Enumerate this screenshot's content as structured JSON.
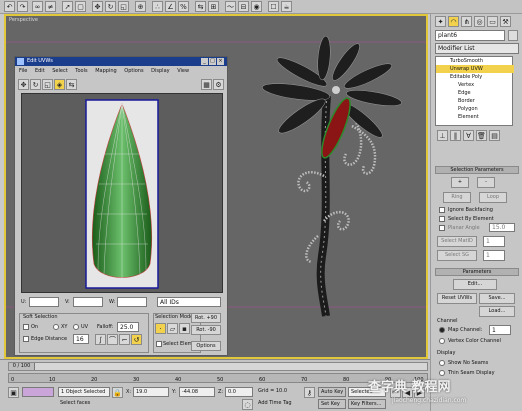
{
  "viewport": {
    "label": "Perspective"
  },
  "command_panel": {
    "object_name": "plant6",
    "modifier_list": "Modifier List",
    "stack": [
      {
        "label": "TurboSmooth"
      },
      {
        "label": "Unwrap UVW"
      },
      {
        "label": "Editable Poly"
      },
      {
        "label": "Vertex"
      },
      {
        "label": "Edge"
      },
      {
        "label": "Border"
      },
      {
        "label": "Polygon"
      },
      {
        "label": "Element"
      }
    ],
    "selection_params": {
      "title": "Selection Parameters",
      "plus": "+",
      "minus": "-",
      "ring": "Ring",
      "loop": "Loop",
      "ignore_backfacing": "Ignore Backfacing",
      "select_by_element": "Select By Element",
      "planar_angle": "Planar Angle",
      "planar_value": "15.0",
      "select_matid": "Select MatID",
      "select_sg": "Select SG",
      "matid_value": "1",
      "sg_value": "1"
    },
    "parameters": {
      "title": "Parameters",
      "edit": "Edit...",
      "reset_uvws": "Reset UVWs",
      "save": "Save...",
      "load": "Load...",
      "channel_title": "Channel",
      "map_channel": "Map Channel:",
      "map_channel_value": "1",
      "vertex_color_channel": "Vertex Color Channel",
      "display_title": "Display",
      "show_no_seams": "Show No Seams",
      "thin_seam_display": "Thin Seam Display"
    }
  },
  "uvw_editor": {
    "title": "Edit UVWs",
    "menu": [
      "File",
      "Edit",
      "Select",
      "Tools",
      "Mapping",
      "Options",
      "Display",
      "View"
    ],
    "u_label": "U:",
    "v_label": "V:",
    "w_label": "W:",
    "u_value": "",
    "v_value": "",
    "w_value": "",
    "ids_dropdown": "All IDs",
    "soft_selection": {
      "title": "Soft Selection",
      "on": "On",
      "xy": "XY",
      "uv": "UV",
      "falloff": "Falloff:",
      "falloff_value": "25.0",
      "edge_distance": "Edge Distance",
      "edge_distance_value": "16"
    },
    "selection_modes": {
      "title": "Selection Modes",
      "select_element": "Select Element",
      "edge_loop": "Edge Loop"
    },
    "rot_plus_90": "Rot. +90",
    "rot_minus_90": "Rot. -90",
    "options": "Options"
  },
  "timeline": {
    "frame_display": "0 / 100",
    "ticks": [
      "0",
      "10",
      "20",
      "30",
      "40",
      "50",
      "60",
      "70",
      "80",
      "90",
      "100"
    ]
  },
  "status": {
    "selected": "1 Object Selected",
    "prompt": "Select faces",
    "x_label": "X:",
    "x_value": "19.0",
    "y_label": "Y:",
    "y_value": "-44.08",
    "z_label": "Z:",
    "z_value": "0.0",
    "grid": "Grid = 10.0",
    "add_time_tag": "Add Time Tag",
    "auto_key": "Auto Key",
    "selected_dropdown": "Selected",
    "set_key": "Set Key",
    "key_filters": "Key Filters..."
  },
  "watermark": {
    "brand": "查字典 教程网",
    "url": "jiaocheng.chazidian.com"
  },
  "colors": {
    "viewport_border": "#e1c83a",
    "leaf_green": "#2b8a2b",
    "petal_red": "#8b1515",
    "uvw_title": "#1a3d8c"
  }
}
